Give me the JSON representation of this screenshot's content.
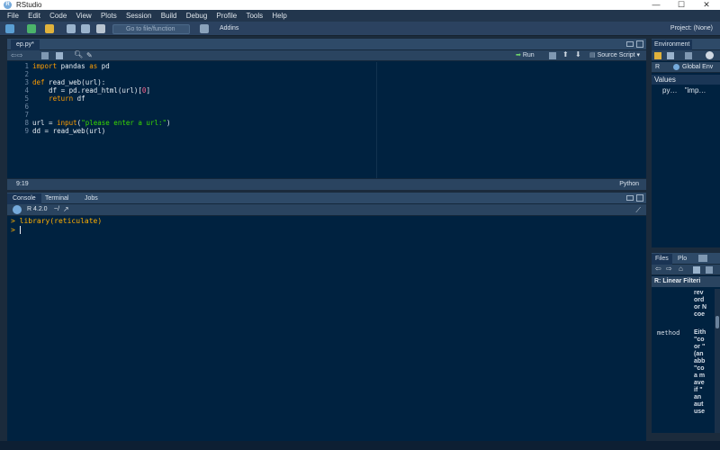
{
  "window": {
    "title": "RStudio",
    "minimize": "—",
    "maximize": "☐",
    "close": "✕"
  },
  "menu": [
    "File",
    "Edit",
    "Code",
    "View",
    "Plots",
    "Session",
    "Build",
    "Debug",
    "Profile",
    "Tools",
    "Help"
  ],
  "toolbar": {
    "goto_placeholder": "Go to file/function",
    "addins_label": "Addins",
    "project_label": "Project: (None)"
  },
  "editor": {
    "tab_label": "ep.py*",
    "run_label": "Run",
    "source_label": "Source Script",
    "cursor_pos": "9:19",
    "language": "Python",
    "line_numbers": [
      "1",
      "2",
      "3",
      "4",
      "5",
      "6",
      "7",
      "8",
      "9"
    ],
    "lines": [
      [
        {
          "t": "import",
          "c": "kw"
        },
        {
          "t": " pandas ",
          "c": ""
        },
        {
          "t": "as",
          "c": "kw"
        },
        {
          "t": " pd",
          "c": ""
        }
      ],
      [],
      [
        {
          "t": "def",
          "c": "kw"
        },
        {
          "t": " read_web(url):",
          "c": ""
        }
      ],
      [
        {
          "t": "    df = pd.read_html(url)[",
          "c": ""
        },
        {
          "t": "0",
          "c": "num"
        },
        {
          "t": "]",
          "c": ""
        }
      ],
      [
        {
          "t": "    ",
          "c": ""
        },
        {
          "t": "return",
          "c": "kw"
        },
        {
          "t": " df",
          "c": ""
        }
      ],
      [],
      [],
      [
        {
          "t": "url = ",
          "c": ""
        },
        {
          "t": "input",
          "c": "kw"
        },
        {
          "t": "(",
          "c": ""
        },
        {
          "t": "\"please enter a url:\"",
          "c": "str"
        },
        {
          "t": ")",
          "c": ""
        }
      ],
      [
        {
          "t": "dd = read_web(url)",
          "c": ""
        }
      ]
    ]
  },
  "console": {
    "tabs": [
      "Console",
      "Terminal",
      "Jobs"
    ],
    "r_version": "R 4.2.0",
    "path": "~/",
    "lines": [
      "> library(reticulate)",
      "> "
    ]
  },
  "environment": {
    "tab_label": "Environment",
    "lang": "R",
    "scope": "Global Env",
    "section": "Values",
    "var_name": "py…",
    "var_value": "\"imp…"
  },
  "files": {
    "tabs": [
      "Files",
      "Plo"
    ],
    "help_title": "R: Linear Filteri",
    "help_top": [
      "rev",
      "ord",
      "or N",
      "coe"
    ],
    "method_label": "method",
    "method_text": [
      "Eith",
      "\"co",
      "or \"",
      "(an",
      "abb",
      "\"co",
      "a m",
      "ave",
      "if \"",
      "an",
      "aut",
      "use"
    ]
  },
  "colors": {
    "accent": "#75aadb",
    "keyword": "#ff9d00",
    "string": "#3ad900",
    "number": "#ff628c"
  }
}
